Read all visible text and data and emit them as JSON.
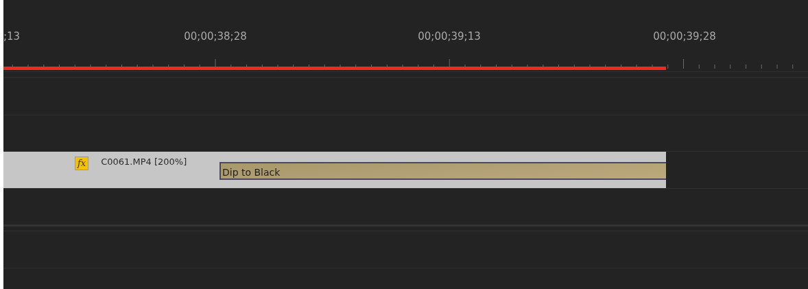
{
  "ruler": {
    "labels": [
      ";13",
      "00;00;38;28",
      "00;00;39;13",
      "00;00;39;28"
    ]
  },
  "clip": {
    "name": "C0061.MP4 [200%]",
    "fx_badge": "fx",
    "transition": "Dip to Black"
  }
}
